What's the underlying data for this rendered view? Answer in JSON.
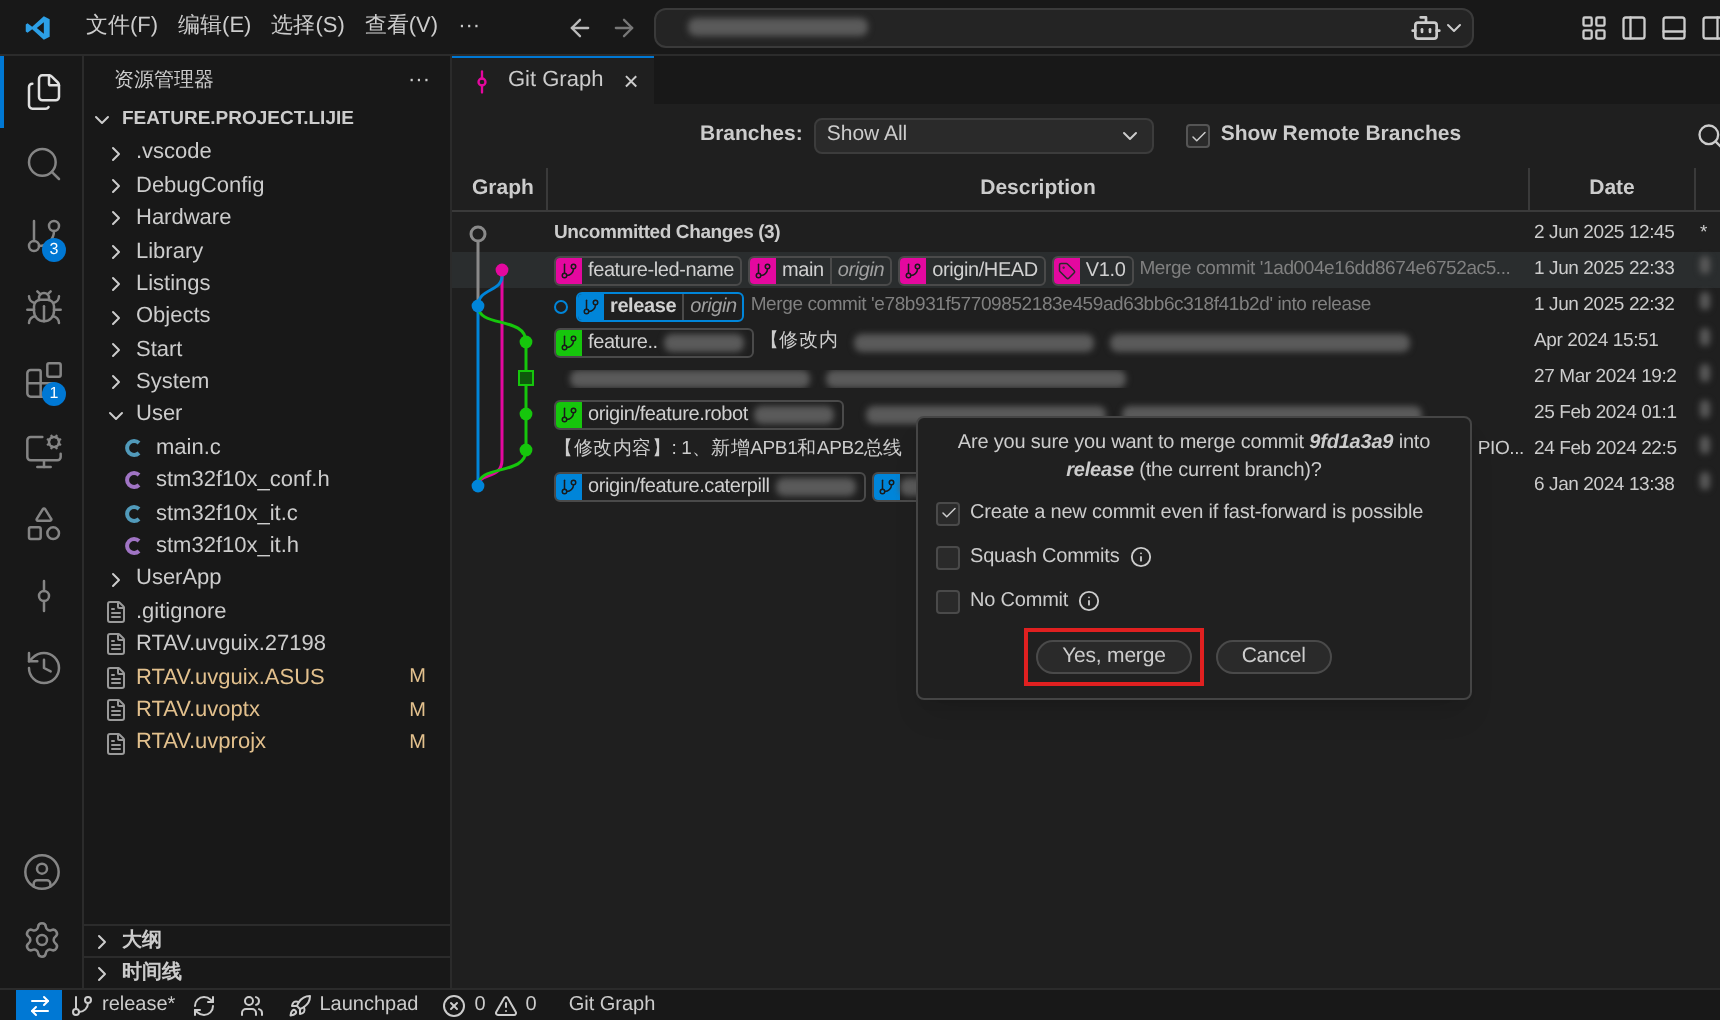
{
  "menu": [
    "文件(F)",
    "编辑(E)",
    "选择(S)",
    "查看(V)",
    "···"
  ],
  "activity_bar": [
    {
      "kind": "explorer",
      "selected": true
    },
    {
      "kind": "search",
      "selected": false
    },
    {
      "kind": "source-control",
      "selected": false,
      "badge": "3"
    },
    {
      "kind": "run",
      "selected": false
    },
    {
      "kind": "extensions",
      "selected": false,
      "badge": "1"
    },
    {
      "kind": "remote",
      "selected": false
    },
    {
      "kind": "shapes",
      "selected": false
    },
    {
      "kind": "git-graph",
      "selected": false
    },
    {
      "kind": "history",
      "selected": false
    }
  ],
  "sidebar": {
    "title": "资源管理器",
    "more": "···",
    "root": {
      "label": "FEATURE.PROJECT.LIJIE",
      "expanded": true,
      "children": [
        {
          "label": ".vscode",
          "kind": "folder",
          "expanded": false
        },
        {
          "label": "DebugConfig",
          "kind": "folder",
          "expanded": false
        },
        {
          "label": "Hardware",
          "kind": "folder",
          "expanded": false
        },
        {
          "label": "Library",
          "kind": "folder",
          "expanded": false
        },
        {
          "label": "Listings",
          "kind": "folder",
          "expanded": false
        },
        {
          "label": "Objects",
          "kind": "folder",
          "expanded": false
        },
        {
          "label": "Start",
          "kind": "folder",
          "expanded": false
        },
        {
          "label": "System",
          "kind": "folder",
          "expanded": false
        },
        {
          "label": "User",
          "kind": "folder",
          "expanded": true,
          "children": [
            {
              "label": "main.c",
              "kind": "c"
            },
            {
              "label": "stm32f10x_conf.h",
              "kind": "h"
            },
            {
              "label": "stm32f10x_it.c",
              "kind": "c"
            },
            {
              "label": "stm32f10x_it.h",
              "kind": "h"
            }
          ]
        },
        {
          "label": "UserApp",
          "kind": "folder",
          "expanded": false
        },
        {
          "label": ".gitignore",
          "kind": "file"
        },
        {
          "label": "RTAV.uvguix.27198",
          "kind": "file"
        },
        {
          "label": "RTAV.uvguix.ASUS",
          "kind": "file",
          "status": "M"
        },
        {
          "label": "RTAV.uvoptx",
          "kind": "file",
          "status": "M"
        },
        {
          "label": "RTAV.uvprojx",
          "kind": "file",
          "status": "M"
        }
      ]
    },
    "sections": [
      {
        "label": "大纲",
        "expanded": false
      },
      {
        "label": "时间线",
        "expanded": false
      }
    ]
  },
  "tab": {
    "title": "Git Graph",
    "close": "×"
  },
  "toolbar": {
    "branches_label": "Branches:",
    "branches_value": "Show All",
    "show_remote": {
      "label": "Show Remote Branches",
      "checked": true
    }
  },
  "table": {
    "columns": [
      "Graph",
      "Description",
      "Date"
    ],
    "rows": [
      {
        "title": "Uncommitted Changes (3)",
        "date": "2 Jun 2025 12:45",
        "extra": "*",
        "selected": false
      },
      {
        "refs": [
          {
            "kind": "branch",
            "name": "feature-led-name",
            "color": "#e4089f"
          },
          {
            "kind": "branch",
            "name": "main",
            "remote": "origin",
            "color": "#e4089f"
          },
          {
            "kind": "branch",
            "name": "origin/HEAD",
            "color": "#e4089f"
          },
          {
            "kind": "tag",
            "name": "V1.0",
            "color": "#e4089f"
          }
        ],
        "message": "Merge commit '1ad004e16dd8674e6752ac5...",
        "date": "1 Jun 2025 22:33",
        "selected": true
      },
      {
        "head": true,
        "refs": [
          {
            "kind": "branch",
            "name": "release",
            "remote": "origin",
            "color": "#0085d9",
            "current": true
          }
        ],
        "message": "Merge commit 'e78b931f57709852183e459ad63bb6c318f41b2d' into release",
        "date": "1 Jun 2025 22:32",
        "selected": false
      },
      {
        "refs": [
          {
            "kind": "branch",
            "name": "feature..",
            "color": "#16c60c",
            "blurred": true
          }
        ],
        "message": "【修改内",
        "message_blurred": true,
        "date": "Apr 2024 15:51",
        "selected": false
      },
      {
        "message_blurred": true,
        "date": "27 Mar 2024 19:2",
        "selected": false
      },
      {
        "refs": [
          {
            "kind": "branch",
            "name": "origin/feature.robot",
            "color": "#16c60c",
            "blurred": true
          }
        ],
        "message_blurred": true,
        "date": "25 Feb 2024 01:1",
        "selected": false
      },
      {
        "message": "【修改内容】: 1、新增APB1和APB2总线",
        "tail": "PIO...",
        "date": "24 Feb 2024 22:5",
        "selected": false
      },
      {
        "refs": [
          {
            "kind": "branch",
            "name": "origin/feature.caterpill",
            "color": "#0085d9",
            "blurred": true
          },
          {
            "kind": "branch",
            "color": "#0085d9",
            "blurred": true
          }
        ],
        "date": "6 Jan 2024 13:38",
        "selected": false
      }
    ]
  },
  "dialog": {
    "question": "Are you sure you want to merge commit **9fd1a3a9** into **release** (the current branch)?",
    "options": [
      {
        "label": "Create a new commit even if fast-forward is possible",
        "checked": true,
        "info": false
      },
      {
        "label": "Squash Commits",
        "checked": false,
        "info": true
      },
      {
        "label": "No Commit",
        "checked": false,
        "info": true
      }
    ],
    "buttons": [
      {
        "label": "Yes, merge",
        "highlighted": true
      },
      {
        "label": "Cancel",
        "highlighted": false
      }
    ]
  },
  "status_bar": [
    {
      "kind": "remote"
    },
    {
      "kind": "branch",
      "text": "release*"
    },
    {
      "kind": "sync"
    },
    {
      "kind": "share"
    },
    {
      "kind": "launchpad",
      "text": "Launchpad"
    },
    {
      "kind": "problems",
      "errors": "0",
      "warnings": "0"
    },
    {
      "kind": "text",
      "text": "Git Graph"
    }
  ]
}
